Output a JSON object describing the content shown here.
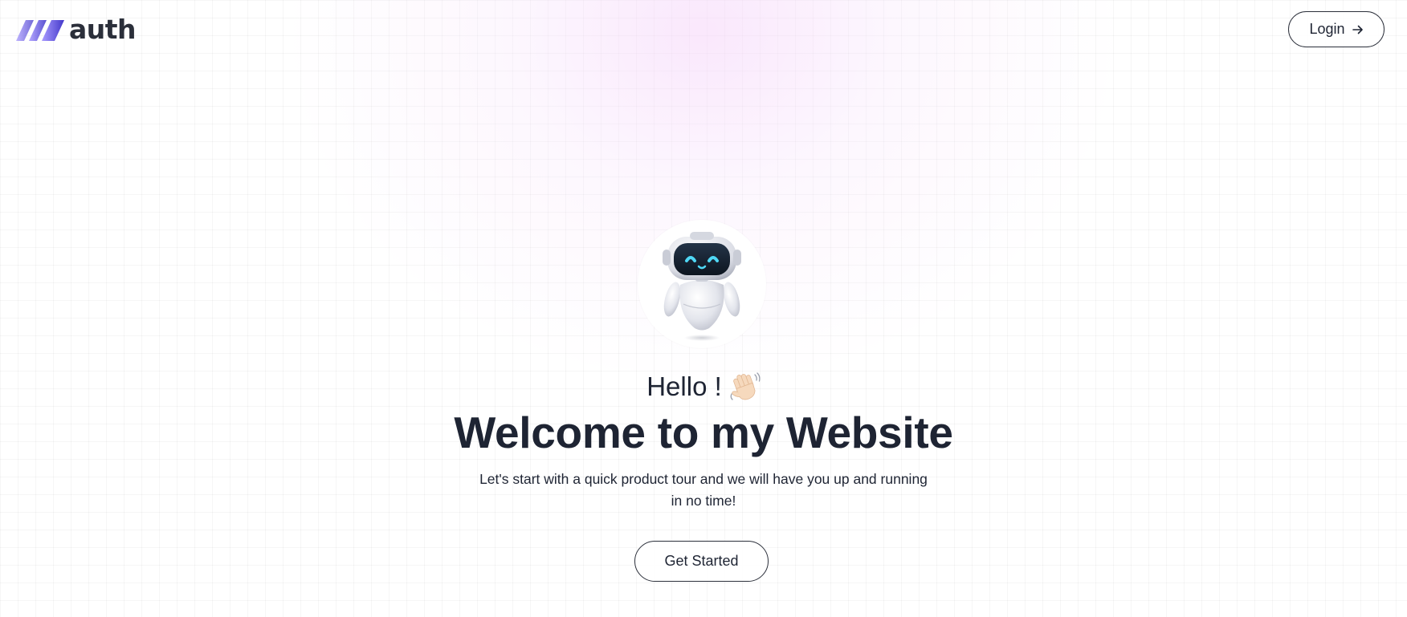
{
  "header": {
    "logo_text": "auth",
    "login_label": "Login",
    "login_icon": "arrow-right-icon"
  },
  "hero": {
    "avatar_icon": "robot-icon",
    "greeting": "Hello !",
    "greeting_icon": "waving-hand-icon",
    "title": "Welcome to my Website",
    "subtitle": "Let's start with a quick product tour and we will have you up and running in no time!",
    "cta_label": "Get Started"
  },
  "colors": {
    "text": "#1e2433",
    "logo_gradient_start": "#a08cff",
    "logo_gradient_end": "#4f46e5",
    "glow": "#f5d4fa"
  }
}
